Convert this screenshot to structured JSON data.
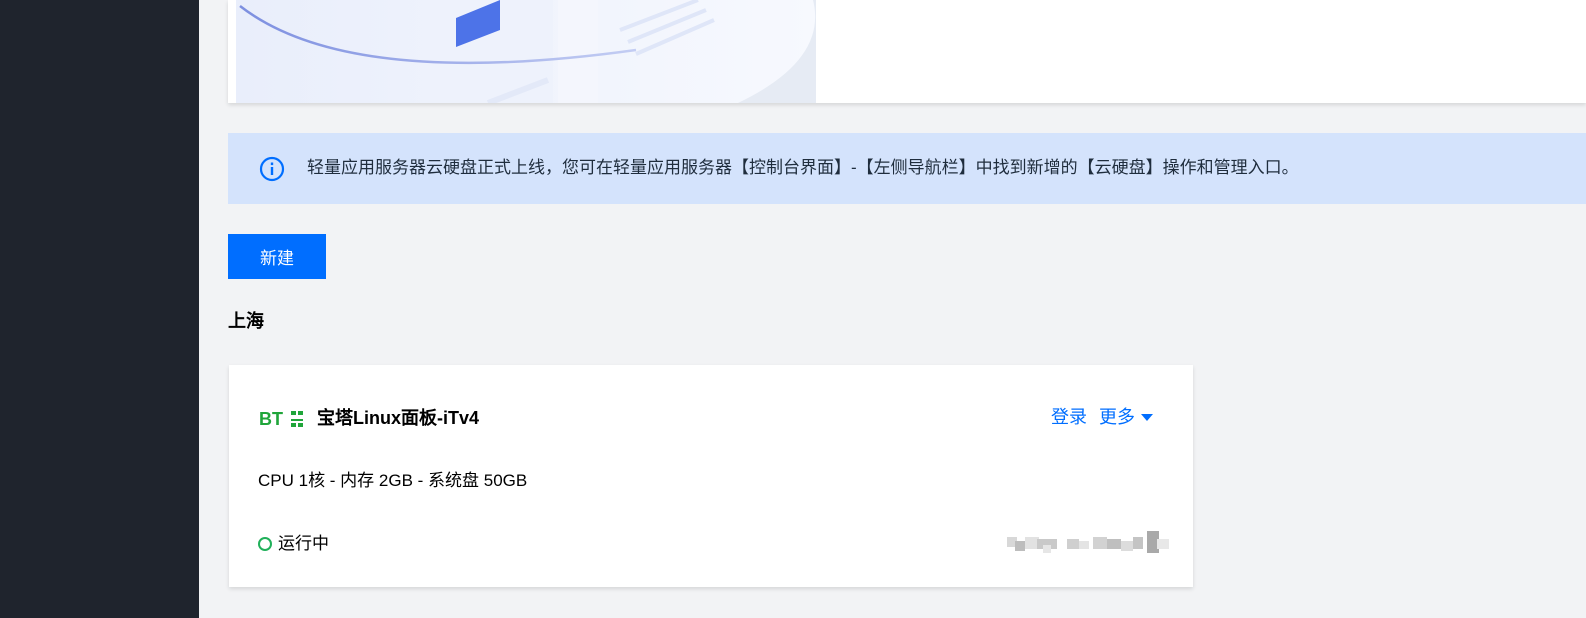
{
  "notice": {
    "text": "轻量应用服务器云硬盘正式上线，您可在轻量应用服务器【控制台界面】-【左侧导航栏】中找到新增的【云硬盘】操作和管理入口。",
    "icon": "info-icon"
  },
  "toolbar": {
    "new_label": "新建"
  },
  "region": {
    "title": "上海"
  },
  "instance": {
    "logo_text": "BT",
    "name": "宝塔Linux面板-iTv4",
    "login_label": "登录",
    "more_label": "更多",
    "spec": "CPU 1核 - 内存 2GB - 系统盘 50GB",
    "status": "运行中",
    "status_color": "#20b05a"
  },
  "colors": {
    "accent": "#006eff",
    "sidebar": "#1f242d",
    "notice_bg": "#d4e3fc",
    "brand_green": "#20a53a"
  }
}
